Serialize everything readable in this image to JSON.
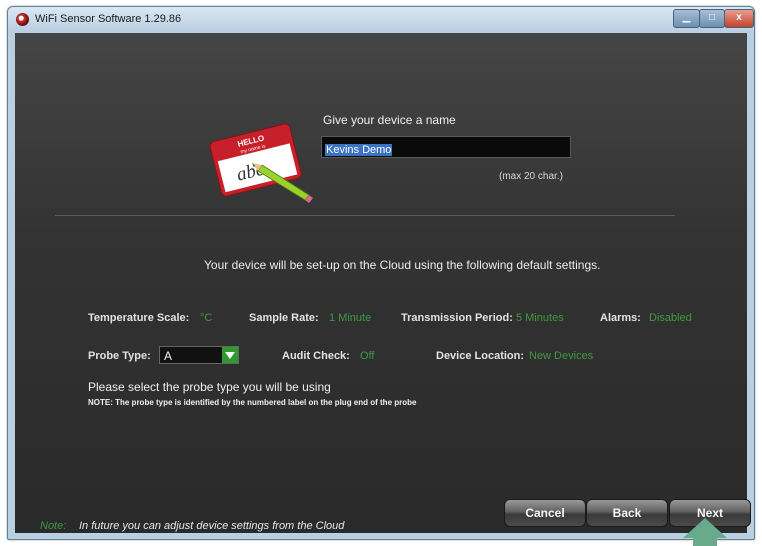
{
  "window": {
    "title": "WiFi Sensor Software 1.29.86",
    "minimize": "▁",
    "maximize": "□",
    "close": "x"
  },
  "name_section": {
    "prompt": "Give your device a name",
    "value": "Kevins Demo",
    "max_hint": "(max 20 char.)",
    "tag_text": "HELLO",
    "tag_sub": "my name is",
    "tag_writing": "abc"
  },
  "info_text": "Your device will be set-up on the Cloud using the following default settings.",
  "settings": {
    "temperature_scale": {
      "label": "Temperature Scale:",
      "value": "°C"
    },
    "sample_rate": {
      "label": "Sample Rate:",
      "value": "1 Minute"
    },
    "transmission_period": {
      "label": "Transmission Period:",
      "value": "5 Minutes"
    },
    "alarms": {
      "label": "Alarms:",
      "value": "Disabled"
    },
    "probe_type": {
      "label": "Probe Type:",
      "value": "A"
    },
    "audit_check": {
      "label": "Audit Check:",
      "value": "Off"
    },
    "device_location": {
      "label": "Device Location:",
      "value": "New Devices"
    }
  },
  "hint": {
    "main": "Please select the probe type you will be using",
    "note": "NOTE: The probe type is identified by the numbered label on the plug end of the probe"
  },
  "footer": {
    "note_label": "Note:",
    "note_text": "In future you can adjust device settings from the Cloud"
  },
  "buttons": {
    "cancel": "Cancel",
    "back": "Back",
    "next": "Next"
  },
  "colors": {
    "value_green": "#3f9a3f",
    "background": "#333333",
    "selection_blue": "#3b73c3",
    "arrow": "#6aaa8c"
  }
}
